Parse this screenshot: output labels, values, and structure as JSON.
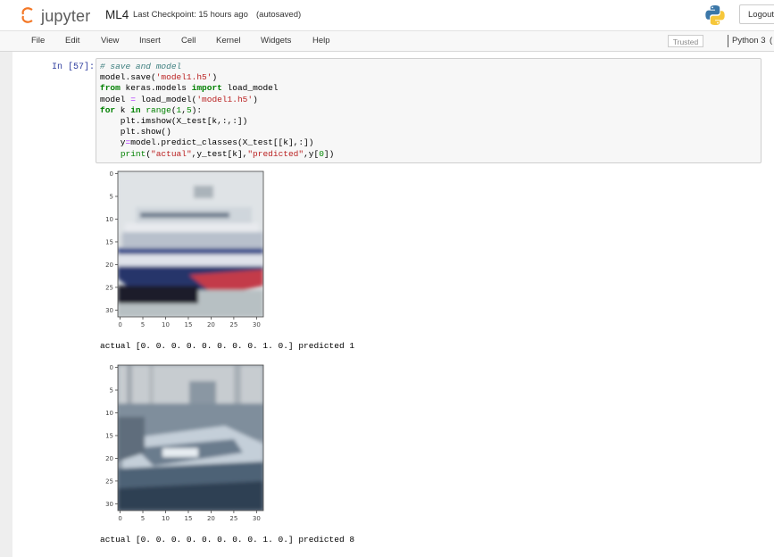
{
  "header": {
    "logo_text": "jupyter",
    "notebook_name": "ML4",
    "checkpoint": "Last Checkpoint: 15 hours ago",
    "autosave_status": "(autosaved)",
    "logout_label": "Logout"
  },
  "menu": {
    "items": [
      "File",
      "Edit",
      "View",
      "Insert",
      "Cell",
      "Kernel",
      "Widgets",
      "Help"
    ],
    "trusted_label": "Trusted",
    "kernel_name": "Python 3",
    "kernel_indicator": "("
  },
  "cell": {
    "prompt": "In [57]:",
    "code_lines": [
      "# save and model",
      "model.save('model1.h5')",
      "from keras.models import load_model",
      "model = load_model('model1.h5')",
      "for k in range(1,5):",
      "    plt.imshow(X_test[k,:,:])",
      "    plt.show()",
      "    y=model.predict_classes(X_test[[k],:])",
      "    print(\"actual\",y_test[k],\"predicted\",y[0])"
    ]
  },
  "outputs": [
    {
      "image": "ship-image",
      "y_ticks": [
        "0",
        "5",
        "10",
        "15",
        "20",
        "25",
        "30"
      ],
      "x_ticks": [
        "0",
        "5",
        "10",
        "15",
        "20",
        "25",
        "30"
      ],
      "text": "actual [0. 0. 0. 0. 0. 0. 0. 0. 1. 0.] predicted 1"
    },
    {
      "image": "boat-image",
      "y_ticks": [
        "0",
        "5",
        "10",
        "15",
        "20",
        "25",
        "30"
      ],
      "x_ticks": [
        "0",
        "5",
        "10",
        "15",
        "20",
        "25",
        "30"
      ],
      "text": "actual [0. 0. 0. 0. 0. 0. 0. 0. 1. 0.] predicted 8"
    }
  ],
  "colors": {
    "jupyter_orange": "#f37726",
    "prompt_blue": "#303f9f",
    "comment": "#408080",
    "string": "#ba2121",
    "keyword": "#008000"
  }
}
